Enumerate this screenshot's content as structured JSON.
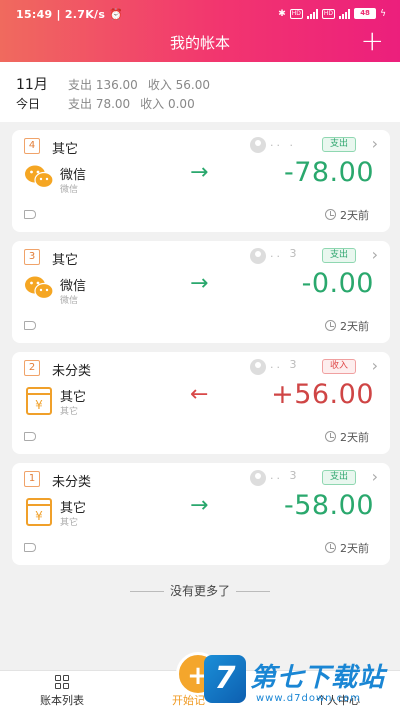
{
  "status_bar": {
    "time": "15:49",
    "speed": "2.7K/s",
    "hd1": "HD",
    "hd2": "HD",
    "battery": "48"
  },
  "header": {
    "title": "我的帐本",
    "add_label": "+"
  },
  "summary": {
    "month": {
      "label": "11月",
      "expense": "支出 136.00",
      "income": "收入 56.00"
    },
    "today": {
      "label": "今日",
      "expense": "支出 78.00",
      "income": "收入 0.00"
    }
  },
  "records": [
    {
      "index": "4",
      "category": "其它",
      "user": "..  .",
      "type": "支出",
      "kind": "out",
      "account": "微信",
      "account_sub": "微信",
      "direction": "→",
      "amount": "-78.00",
      "time": "2天前",
      "icon": "wechat-icon"
    },
    {
      "index": "3",
      "category": "其它",
      "user": "..  3",
      "type": "支出",
      "kind": "out",
      "account": "微信",
      "account_sub": "微信",
      "direction": "→",
      "amount": "-0.00",
      "time": "2天前",
      "icon": "wechat-icon"
    },
    {
      "index": "2",
      "category": "未分类",
      "user": "..  3",
      "type": "收入",
      "kind": "in",
      "account": "其它",
      "account_sub": "其它",
      "direction": "←",
      "amount": "+56.00",
      "time": "2天前",
      "icon": "wallet-icon"
    },
    {
      "index": "1",
      "category": "未分类",
      "user": "..  3",
      "type": "支出",
      "kind": "out",
      "account": "其它",
      "account_sub": "其它",
      "direction": "→",
      "amount": "-58.00",
      "time": "2天前",
      "icon": "wallet-icon"
    }
  ],
  "footer_text": "没有更多了",
  "tabbar": {
    "ledger_list": "账本列表",
    "start": "开始记",
    "personal": "个人中心",
    "plus": "+"
  },
  "watermark": {
    "text": "第七下载站",
    "url": "www.d7down.com",
    "logo": "7"
  },
  "colors": {
    "header_start": "#f06a5e",
    "header_end": "#ec1f7c",
    "expense": "#2aa86d",
    "income": "#cf4545",
    "accent": "#f4a62c"
  }
}
